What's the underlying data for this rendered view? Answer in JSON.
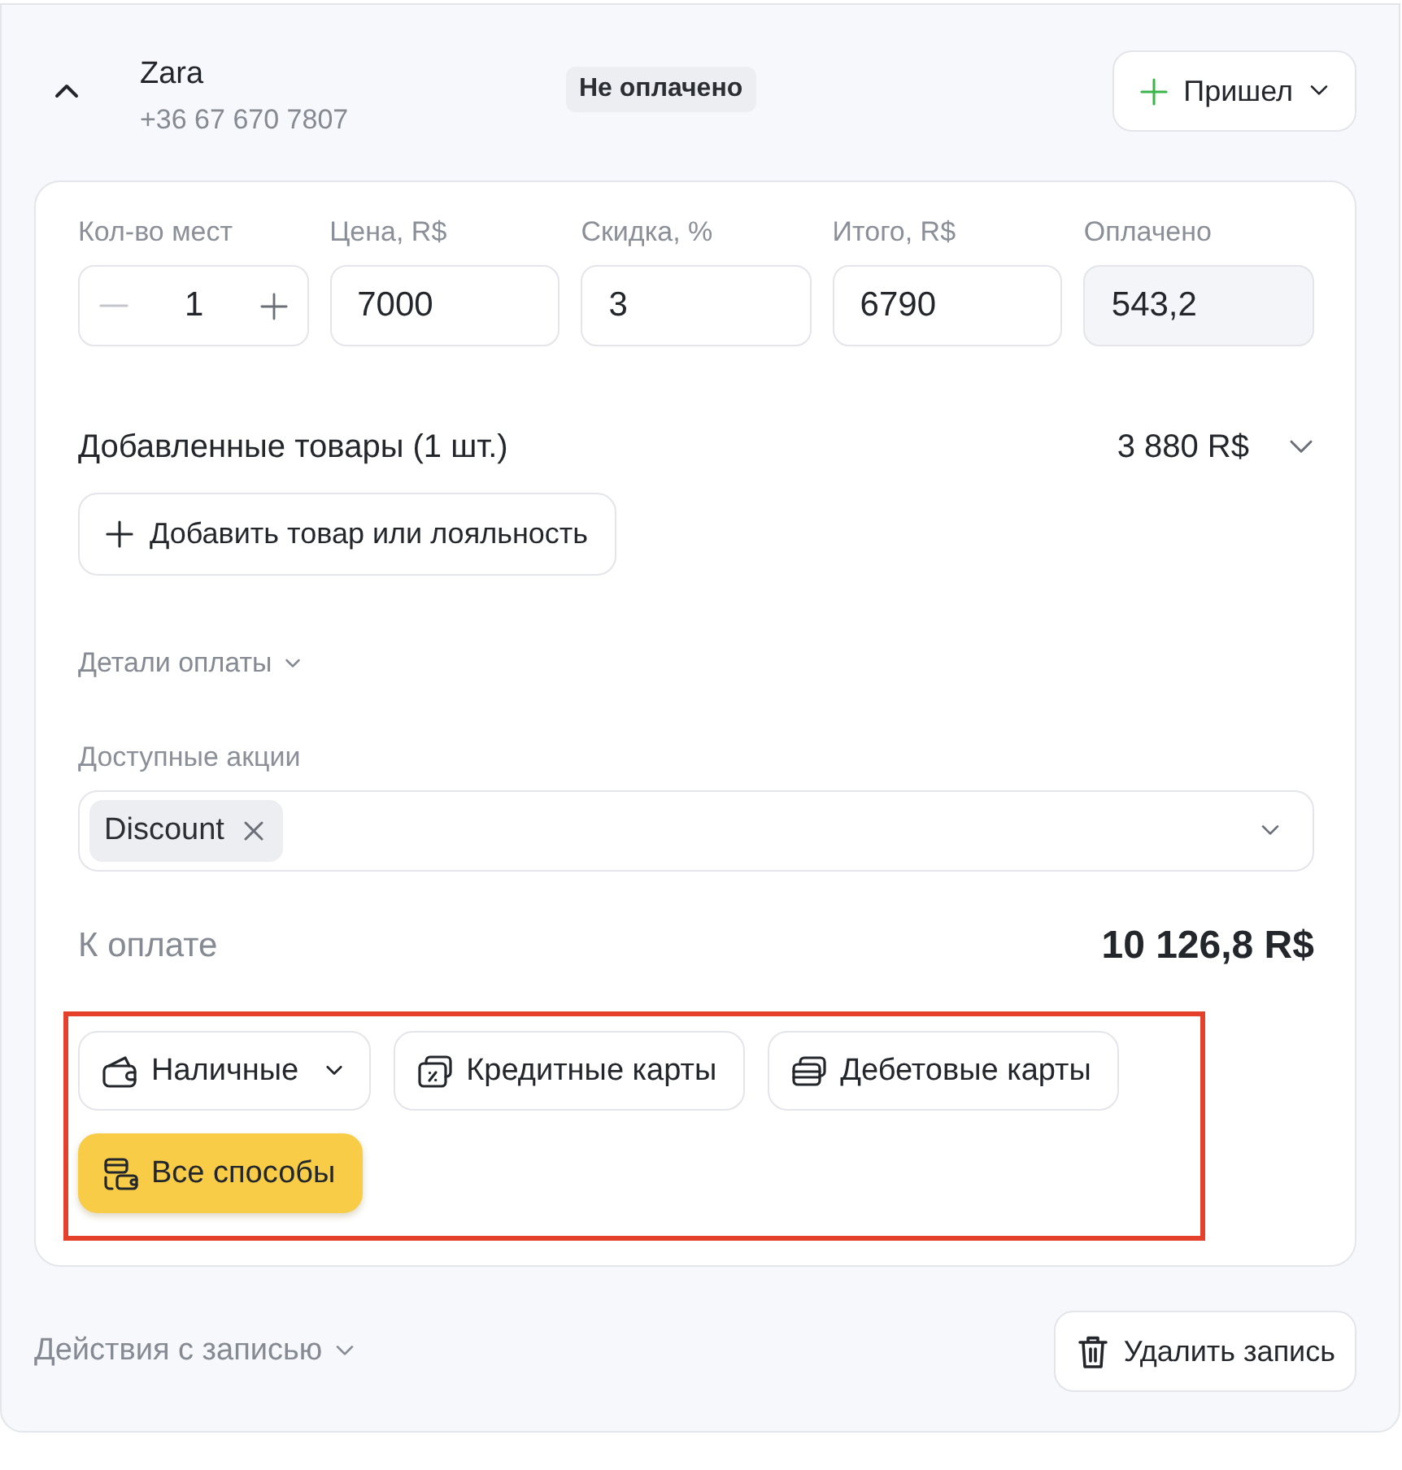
{
  "record": {
    "expanded": true,
    "client_name": "Zara",
    "phone": "+36 67 670 7807",
    "payment_status": "Не оплачено",
    "status_button": "Пришел"
  },
  "fields": [
    {
      "label": "Кол-во мест",
      "kind": "stepper",
      "value": "1"
    },
    {
      "label": "Цена, R$",
      "kind": "input",
      "value": "7000"
    },
    {
      "label": "Скидка, %",
      "kind": "input",
      "value": "3"
    },
    {
      "label": "Итого, R$",
      "kind": "input",
      "value": "6790"
    },
    {
      "label": "Оплачено",
      "kind": "readonly",
      "value": "543,2"
    }
  ],
  "added_goods": {
    "title": "Добавленные товары (1 шт.)",
    "total": "3 880 R$",
    "expanded": false
  },
  "add_button": "Добавить товар или лояльность",
  "payment_details": {
    "label": "Детали оплаты",
    "expanded": false
  },
  "promotions": {
    "label": "Доступные акции",
    "chips": [
      "Discount"
    ]
  },
  "to_pay": {
    "label": "К оплате",
    "amount": "10 126,8 R$"
  },
  "payment_methods": {
    "highlighted": true,
    "items": [
      {
        "label": "Наличные",
        "kind": "cash",
        "has_menu": true,
        "selected": false
      },
      {
        "label": "Кредитные карты",
        "kind": "credit",
        "has_menu": false,
        "selected": false
      },
      {
        "label": "Дебетовые карты",
        "kind": "debit",
        "has_menu": false,
        "selected": false
      },
      {
        "label": "Все способы",
        "kind": "all",
        "has_menu": false,
        "selected": true
      }
    ]
  },
  "footer": {
    "actions_label": "Действия с записью",
    "delete_button": "Удалить запись"
  }
}
